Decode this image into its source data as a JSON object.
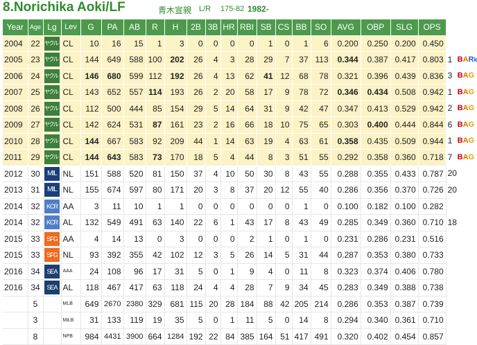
{
  "header": {
    "title": "8.Norichika Aoki/LF",
    "kanji": "青木宣親",
    "bats_throws": "L/R",
    "height_weight": "175-82",
    "birth_year": "1982-"
  },
  "columns": [
    "Year",
    "Age",
    "Lg",
    "Lev",
    "G",
    "PA",
    "AB",
    "R",
    "H",
    "2B",
    "3B",
    "HR",
    "RBI",
    "SB",
    "CS",
    "BB",
    "SO",
    "AVG",
    "OBP",
    "SLG",
    "OPS"
  ],
  "rows": [
    {
      "style": "yellow",
      "year": "2004",
      "age": "22",
      "lg": "ヤクルト",
      "lg_type": "yak",
      "lev": "CL",
      "vals": [
        "10",
        "16",
        "15",
        "1",
        "3",
        "0",
        "0",
        "0",
        "0",
        "1",
        "0",
        "1",
        "6",
        "0.200",
        "0.250",
        "0.200",
        "0.450"
      ],
      "bold": [],
      "extra": "",
      "awards": []
    },
    {
      "style": "yellow",
      "year": "2005",
      "age": "23",
      "lg": "ヤクルト",
      "lg_type": "yak",
      "lev": "CL",
      "vals": [
        "144",
        "649",
        "588",
        "100",
        "202",
        "26",
        "4",
        "3",
        "28",
        "29",
        "7",
        "37",
        "113",
        "0.344",
        "0.387",
        "0.417",
        "0.803"
      ],
      "bold": [
        4,
        13
      ],
      "extra": "1",
      "awards": [
        "B",
        "A",
        "R",
        "k"
      ]
    },
    {
      "style": "yellow",
      "year": "2006",
      "age": "24",
      "lg": "ヤクルト",
      "lg_type": "yak",
      "lev": "CL",
      "vals": [
        "146",
        "680",
        "599",
        "112",
        "192",
        "26",
        "4",
        "13",
        "62",
        "41",
        "12",
        "68",
        "78",
        "0.321",
        "0.396",
        "0.439",
        "0.836"
      ],
      "bold": [
        0,
        1,
        4,
        9
      ],
      "extra": "3",
      "awards": [
        "B",
        "A",
        "G"
      ]
    },
    {
      "style": "yellow",
      "year": "2007",
      "age": "25",
      "lg": "ヤクルト",
      "lg_type": "yak",
      "lev": "CL",
      "vals": [
        "143",
        "652",
        "557",
        "114",
        "193",
        "26",
        "2",
        "20",
        "58",
        "17",
        "9",
        "78",
        "72",
        "0.346",
        "0.434",
        "0.508",
        "0.942"
      ],
      "bold": [
        3,
        13,
        14
      ],
      "extra": "1",
      "awards": [
        "B",
        "A",
        "G"
      ]
    },
    {
      "style": "yellow",
      "year": "2008",
      "age": "26",
      "lg": "ヤクルト",
      "lg_type": "yak",
      "lev": "CL",
      "vals": [
        "112",
        "500",
        "444",
        "85",
        "154",
        "29",
        "5",
        "14",
        "64",
        "31",
        "9",
        "42",
        "47",
        "0.347",
        "0.413",
        "0.529",
        "0.942"
      ],
      "bold": [],
      "extra": "2",
      "awards": [
        "B",
        "A",
        "G"
      ]
    },
    {
      "style": "yellow",
      "year": "2009",
      "age": "27",
      "lg": "ヤクルト",
      "lg_type": "yak",
      "lev": "CL",
      "vals": [
        "142",
        "624",
        "531",
        "87",
        "161",
        "23",
        "2",
        "16",
        "66",
        "18",
        "10",
        "75",
        "65",
        "0.303",
        "0.400",
        "0.444",
        "0.844"
      ],
      "bold": [
        3,
        14
      ],
      "extra": "6",
      "awards": [
        "B",
        "A",
        "G"
      ]
    },
    {
      "style": "yellow",
      "year": "2010",
      "age": "28",
      "lg": "ヤクルト",
      "lg_type": "yak",
      "lev": "CL",
      "vals": [
        "144",
        "667",
        "583",
        "92",
        "209",
        "44",
        "1",
        "14",
        "63",
        "19",
        "4",
        "63",
        "61",
        "0.358",
        "0.435",
        "0.509",
        "0.944"
      ],
      "bold": [
        0,
        13
      ],
      "extra": "1",
      "awards": [
        "B",
        "A",
        "G"
      ]
    },
    {
      "style": "yellow",
      "year": "2011",
      "age": "29",
      "lg": "ヤクルト",
      "lg_type": "yak",
      "lev": "CL",
      "vals": [
        "144",
        "643",
        "583",
        "73",
        "170",
        "18",
        "5",
        "4",
        "44",
        "8",
        "3",
        "51",
        "55",
        "0.292",
        "0.358",
        "0.360",
        "0.718"
      ],
      "bold": [
        0,
        1,
        3
      ],
      "extra": "7",
      "awards": [
        "B",
        "A",
        "G"
      ]
    },
    {
      "style": "white",
      "year": "2012",
      "age": "30",
      "lg": "MIL",
      "lg_type": "mil",
      "lev": "NL",
      "vals": [
        "151",
        "588",
        "520",
        "81",
        "150",
        "37",
        "4",
        "10",
        "50",
        "30",
        "8",
        "43",
        "55",
        "0.288",
        "0.355",
        "0.433",
        "0.787"
      ],
      "bold": [],
      "extra": "20",
      "awards": []
    },
    {
      "style": "white",
      "year": "2013",
      "age": "31",
      "lg": "MIL",
      "lg_type": "mil",
      "lev": "NL",
      "vals": [
        "155",
        "674",
        "597",
        "80",
        "171",
        "20",
        "3",
        "8",
        "37",
        "20",
        "12",
        "55",
        "40",
        "0.286",
        "0.356",
        "0.370",
        "0.726"
      ],
      "bold": [],
      "extra": "20",
      "awards": []
    },
    {
      "style": "white",
      "year": "2014",
      "age": "32",
      "lg": "KCR",
      "lg_type": "kcr",
      "lev": "AA",
      "vals": [
        "3",
        "11",
        "10",
        "1",
        "1",
        "0",
        "0",
        "0",
        "0",
        "0",
        "0",
        "1",
        "0",
        "0.100",
        "0.182",
        "0.100",
        "0.282"
      ],
      "bold": [],
      "extra": "",
      "awards": []
    },
    {
      "style": "white",
      "year": "2014",
      "age": "32",
      "lg": "KCR",
      "lg_type": "kcr",
      "lev": "AL",
      "vals": [
        "132",
        "549",
        "491",
        "63",
        "140",
        "22",
        "6",
        "1",
        "43",
        "17",
        "8",
        "43",
        "49",
        "0.285",
        "0.349",
        "0.360",
        "0.710"
      ],
      "bold": [],
      "extra": "18",
      "awards": []
    },
    {
      "style": "white",
      "year": "2015",
      "age": "33",
      "lg": "SFG",
      "lg_type": "sfg",
      "lev": "AA",
      "vals": [
        "4",
        "14",
        "13",
        "0",
        "3",
        "0",
        "0",
        "0",
        "2",
        "1",
        "0",
        "1",
        "0",
        "0.231",
        "0.286",
        "0.231",
        "0.516"
      ],
      "bold": [],
      "extra": "",
      "awards": []
    },
    {
      "style": "white",
      "year": "2015",
      "age": "33",
      "lg": "SFG",
      "lg_type": "sfg",
      "lev": "NL",
      "vals": [
        "93",
        "392",
        "355",
        "42",
        "102",
        "12",
        "3",
        "5",
        "26",
        "14",
        "5",
        "31",
        "44",
        "0.287",
        "0.353",
        "0.380",
        "0.733"
      ],
      "bold": [],
      "extra": "",
      "awards": []
    },
    {
      "style": "white",
      "year": "2016",
      "age": "34",
      "lg": "SEA",
      "lg_type": "sea",
      "lev": "AAA",
      "vals": [
        "24",
        "108",
        "96",
        "17",
        "31",
        "5",
        "0",
        "1",
        "9",
        "4",
        "0",
        "11",
        "8",
        "0.323",
        "0.374",
        "0.406",
        "0.780"
      ],
      "bold": [],
      "extra": "",
      "awards": [],
      "small_lev": true
    },
    {
      "style": "white",
      "year": "2016",
      "age": "34",
      "lg": "SEA",
      "lg_type": "sea",
      "lev": "AL",
      "vals": [
        "118",
        "467",
        "417",
        "63",
        "118",
        "24",
        "4",
        "4",
        "28",
        "7",
        "9",
        "34",
        "45",
        "0.283",
        "0.349",
        "0.388",
        "0.738"
      ],
      "bold": [],
      "extra": "",
      "awards": []
    },
    {
      "style": "total",
      "year": "",
      "age": "5",
      "lg": "",
      "lg_type": "",
      "lev": "MLB",
      "vals": [
        "649",
        "2670",
        "2380",
        "329",
        "681",
        "115",
        "20",
        "28",
        "184",
        "88",
        "42",
        "205",
        "214",
        "0.286",
        "0.353",
        "0.387",
        "0.739"
      ],
      "bold": [],
      "extra": "",
      "awards": [],
      "small_lev": true
    },
    {
      "style": "total",
      "year": "",
      "age": "3",
      "lg": "",
      "lg_type": "",
      "lev": "MiLB",
      "vals": [
        "31",
        "133",
        "119",
        "19",
        "35",
        "5",
        "0",
        "1",
        "11",
        "5",
        "0",
        "14",
        "8",
        "0.294",
        "0.340",
        "0.361",
        "0.710"
      ],
      "bold": [],
      "extra": "",
      "awards": [],
      "small_lev": true
    },
    {
      "style": "total",
      "year": "",
      "age": "8",
      "lg": "",
      "lg_type": "",
      "lev": "NPB",
      "vals": [
        "984",
        "4431",
        "3900",
        "664",
        "1284",
        "192",
        "22",
        "84",
        "385",
        "164",
        "51",
        "417",
        "491",
        "0.320",
        "0.402",
        "0.454",
        "0.857"
      ],
      "bold": [],
      "extra": "",
      "awards": [],
      "small_lev": true
    }
  ]
}
